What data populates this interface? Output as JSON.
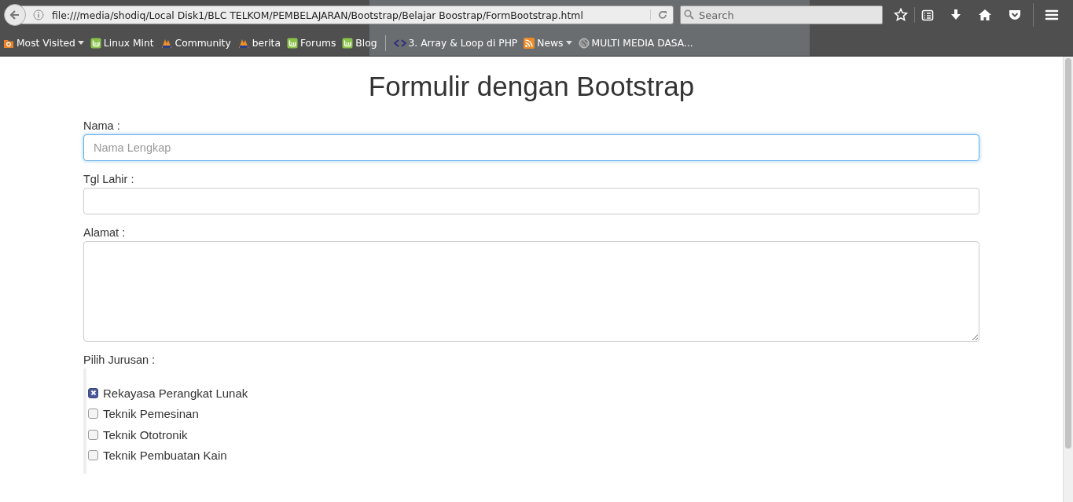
{
  "browser": {
    "url": "file:///media/shodiq/Local Disk1/BLC TELKOM/PEMBELAJARAN/Bootstrap/Belajar Boostrap/FormBootstrap.html",
    "search_placeholder": "Search",
    "bookmarks": [
      {
        "kind": "folder",
        "label": "Most Visited",
        "dropdown": true
      },
      {
        "kind": "mint",
        "label": "Linux Mint",
        "dropdown": false
      },
      {
        "kind": "flame",
        "label": "Community",
        "dropdown": false
      },
      {
        "kind": "flame",
        "label": "berita",
        "dropdown": false
      },
      {
        "kind": "mint",
        "label": "Forums",
        "dropdown": false
      },
      {
        "kind": "mint",
        "label": "Blog",
        "dropdown": false
      },
      {
        "kind": "separator"
      },
      {
        "kind": "code",
        "label": "3. Array & Loop di PHP",
        "dropdown": false
      },
      {
        "kind": "rss",
        "label": "News",
        "dropdown": true
      },
      {
        "kind": "globe",
        "label": "MULTI MEDIA DASA...",
        "dropdown": false
      }
    ]
  },
  "page": {
    "title": "Formulir dengan Bootstrap",
    "fields": [
      {
        "kind": "input",
        "label": "Nama :",
        "placeholder": "Nama Lengkap",
        "focused": true
      },
      {
        "kind": "input",
        "label": "Tgl Lahir :",
        "focused": false
      },
      {
        "kind": "textarea",
        "label": "Alamat :",
        "focused": false
      }
    ],
    "checkbox_group": {
      "label": "Pilih Jurusan :",
      "options": [
        {
          "label": "Rekayasa Perangkat Lunak",
          "checked": true
        },
        {
          "label": "Teknik Pemesinan",
          "checked": false
        },
        {
          "label": "Teknik Ototronik",
          "checked": false
        },
        {
          "label": "Teknik Pembuatan Kain",
          "checked": false
        }
      ]
    }
  }
}
